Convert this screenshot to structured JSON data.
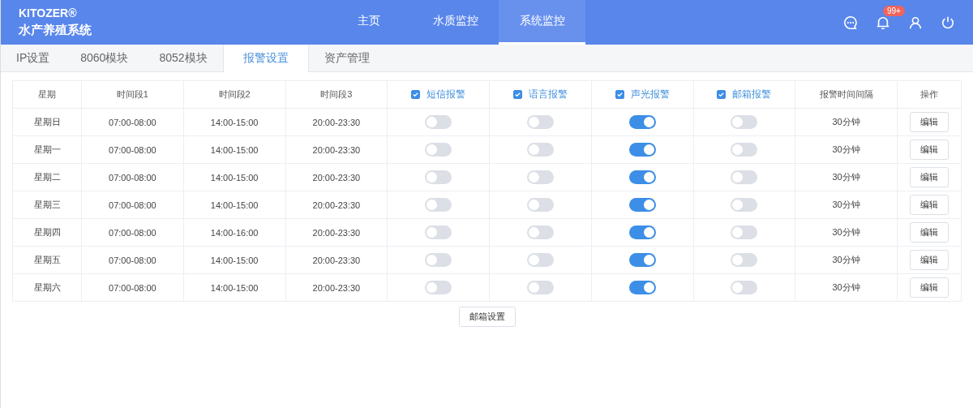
{
  "brand": {
    "name": "KITOZER®",
    "subtitle": "水产养殖系统"
  },
  "nav": [
    {
      "label": "主页",
      "selected": false
    },
    {
      "label": "水质监控",
      "selected": false
    },
    {
      "label": "系统监控",
      "selected": true
    }
  ],
  "notification_badge": "99+",
  "tabs": [
    {
      "label": "IP设置",
      "selected": false
    },
    {
      "label": "8060模块",
      "selected": false
    },
    {
      "label": "8052模块",
      "selected": false
    },
    {
      "label": "报警设置",
      "selected": true
    },
    {
      "label": "资产管理",
      "selected": false
    }
  ],
  "table": {
    "columns": [
      {
        "label": "星期",
        "kind": "text"
      },
      {
        "label": "时间段1",
        "kind": "text"
      },
      {
        "label": "时间段2",
        "kind": "text"
      },
      {
        "label": "时间段3",
        "kind": "text"
      },
      {
        "label": "短信报警",
        "kind": "check",
        "checked": true
      },
      {
        "label": "语言报警",
        "kind": "check",
        "checked": true
      },
      {
        "label": "声光报警",
        "kind": "check",
        "checked": true
      },
      {
        "label": "邮箱报警",
        "kind": "check",
        "checked": true
      },
      {
        "label": "报警时间间隔",
        "kind": "text"
      },
      {
        "label": "操作",
        "kind": "text"
      }
    ],
    "rows": [
      {
        "day": "星期日",
        "t1": "07:00-08:00",
        "t2": "14:00-15:00",
        "t3": "20:00-23:30",
        "switches": [
          false,
          false,
          true,
          false
        ],
        "interval": "30分钟",
        "action": "编辑"
      },
      {
        "day": "星期一",
        "t1": "07:00-08:00",
        "t2": "14:00-15:00",
        "t3": "20:00-23:30",
        "switches": [
          false,
          false,
          true,
          false
        ],
        "interval": "30分钟",
        "action": "编辑"
      },
      {
        "day": "星期二",
        "t1": "07:00-08:00",
        "t2": "14:00-15:00",
        "t3": "20:00-23:30",
        "switches": [
          false,
          false,
          true,
          false
        ],
        "interval": "30分钟",
        "action": "编辑"
      },
      {
        "day": "星期三",
        "t1": "07:00-08:00",
        "t2": "14:00-15:00",
        "t3": "20:00-23:30",
        "switches": [
          false,
          false,
          true,
          false
        ],
        "interval": "30分钟",
        "action": "编辑"
      },
      {
        "day": "星期四",
        "t1": "07:00-08:00",
        "t2": "14:00-16:00",
        "t3": "20:00-23:30",
        "switches": [
          false,
          false,
          true,
          false
        ],
        "interval": "30分钟",
        "action": "编辑"
      },
      {
        "day": "星期五",
        "t1": "07:00-08:00",
        "t2": "14:00-15:00",
        "t3": "20:00-23:30",
        "switches": [
          false,
          false,
          true,
          false
        ],
        "interval": "30分钟",
        "action": "编辑"
      },
      {
        "day": "星期六",
        "t1": "07:00-08:00",
        "t2": "14:00-15:00",
        "t3": "20:00-23:30",
        "switches": [
          false,
          false,
          true,
          false
        ],
        "interval": "30分钟",
        "action": "编辑"
      }
    ]
  },
  "email_settings_button": "邮箱设置"
}
